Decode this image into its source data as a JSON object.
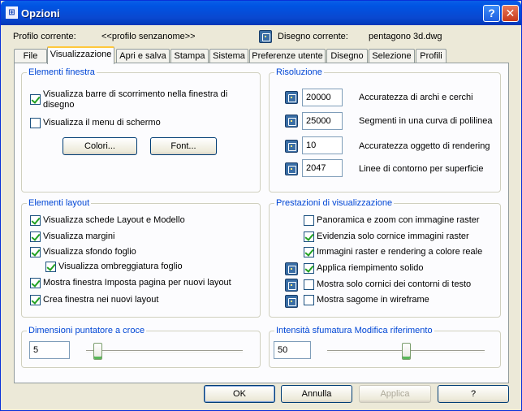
{
  "window": {
    "title": "Opzioni",
    "help_label": "?",
    "close_label": "✕"
  },
  "header": {
    "profile_label": "Profilo corrente:",
    "profile_value": "<<profilo senzanome>>",
    "drawing_label": "Disegno corrente:",
    "drawing_value": "pentagono 3d.dwg"
  },
  "tabs": [
    "File",
    "Visualizzazione",
    "Apri e salva",
    "Stampa",
    "Sistema",
    "Preferenze utente",
    "Disegno",
    "Selezione",
    "Profili"
  ],
  "active_tab": "Visualizzazione",
  "window_elements": {
    "title": "Elementi finestra",
    "scrollbars_label_1": "Visualizza barre di scorrimento nella finestra di",
    "scrollbars_label_2": "disegno",
    "scrollbars_checked": true,
    "screen_menu_label": "Visualizza il menu di schermo",
    "screen_menu_checked": false,
    "colors_button": "Colori...",
    "font_button": "Font..."
  },
  "resolution": {
    "title": "Risoluzione",
    "items": [
      {
        "value": "20000",
        "label": "Accuratezza di archi e cerchi"
      },
      {
        "value": "25000",
        "label": "Segmenti in una curva di polilinea"
      },
      {
        "value": "10",
        "label": "Accuratezza oggetto di rendering"
      },
      {
        "value": "2047",
        "label": "Linee di contorno per superficie"
      }
    ]
  },
  "layout_elements": {
    "title": "Elementi layout",
    "items": [
      {
        "label": "Visualizza schede Layout e Modello",
        "checked": true
      },
      {
        "label": "Visualizza margini",
        "checked": true
      },
      {
        "label": "Visualizza sfondo foglio",
        "checked": true
      },
      {
        "label": "Visualizza ombreggiatura foglio",
        "checked": true
      },
      {
        "label": "Mostra finestra Imposta pagina per nuovi layout",
        "checked": true
      },
      {
        "label": "Crea finestra nei nuovi layout",
        "checked": true
      }
    ]
  },
  "display_performance": {
    "title": "Prestazioni di visualizzazione",
    "items": [
      {
        "label": "Panoramica e zoom con immagine raster",
        "checked": false
      },
      {
        "label": "Evidenzia solo cornice immagini raster",
        "checked": true
      },
      {
        "label": "Immagini raster e rendering a colore reale",
        "checked": true
      },
      {
        "label": "Applica riempimento solido",
        "checked": true
      },
      {
        "label": "Mostra solo cornici dei contorni di testo",
        "checked": false
      },
      {
        "label": "Mostra sagome in wireframe",
        "checked": false
      }
    ]
  },
  "crosshair": {
    "title": "Dimensioni puntatore a croce",
    "value": "5",
    "slider_fraction": 0.05
  },
  "xref_fading": {
    "title": "Intensità sfumatura Modifica riferimento",
    "value": "50",
    "slider_fraction": 0.5
  },
  "footer": {
    "ok_label": "OK",
    "cancel_label": "Annulla",
    "apply_label": "Applica",
    "help_label": "?"
  }
}
